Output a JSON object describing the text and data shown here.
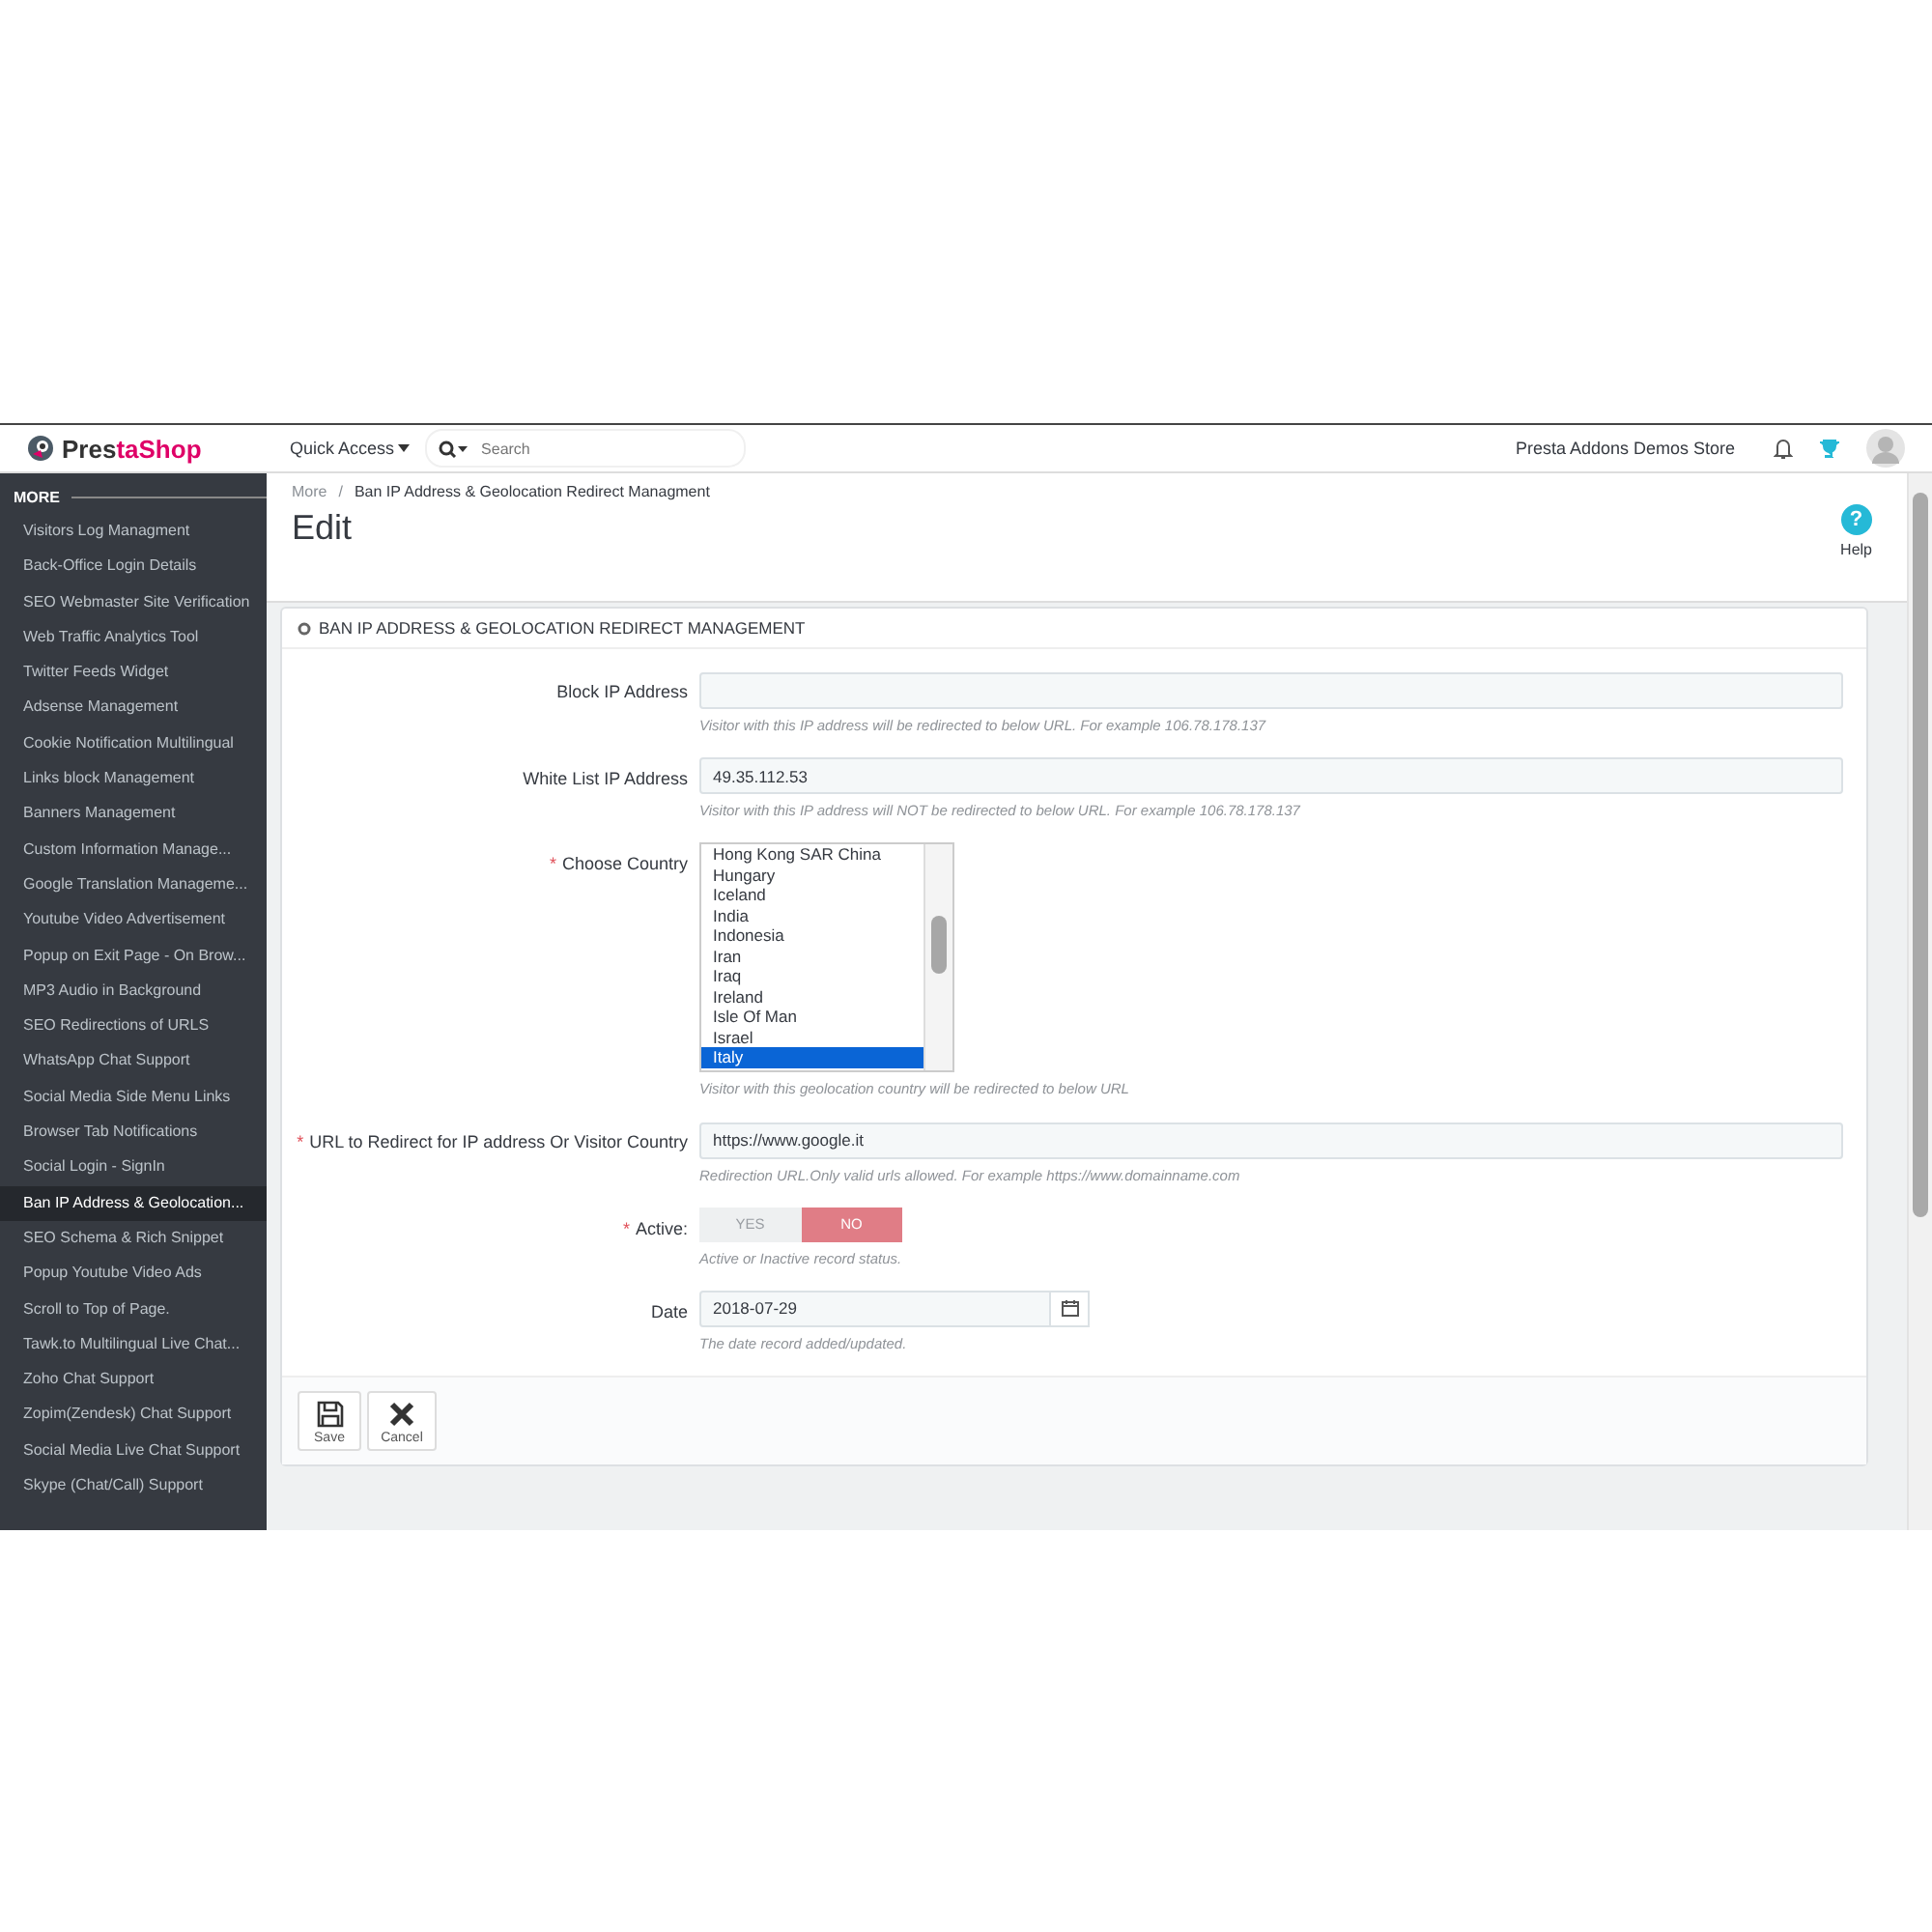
{
  "header": {
    "logo": "PrestaShop",
    "quick_access": "Quick Access",
    "search": {
      "placeholder": "Search"
    },
    "shop_name": "Presta Addons Demos Store"
  },
  "sidebar": {
    "section": "MORE",
    "items": [
      {
        "label": "Visitors Log Managment",
        "selected": false
      },
      {
        "label": "Back-Office Login Details",
        "selected": false
      },
      {
        "label": "SEO Webmaster Site Verification",
        "selected": false
      },
      {
        "label": "Web Traffic Analytics Tool",
        "selected": false
      },
      {
        "label": "Twitter Feeds Widget",
        "selected": false
      },
      {
        "label": "Adsense Management",
        "selected": false
      },
      {
        "label": "Cookie Notification Multilingual",
        "selected": false
      },
      {
        "label": "Links block Management",
        "selected": false
      },
      {
        "label": "Banners Management",
        "selected": false
      },
      {
        "label": "Custom Information Manage...",
        "selected": false
      },
      {
        "label": "Google Translation Manageme...",
        "selected": false
      },
      {
        "label": "Youtube Video Advertisement",
        "selected": false
      },
      {
        "label": "Popup on Exit Page - On Brow...",
        "selected": false
      },
      {
        "label": "MP3 Audio in Background",
        "selected": false
      },
      {
        "label": "SEO Redirections of URLS",
        "selected": false
      },
      {
        "label": "WhatsApp Chat Support",
        "selected": false
      },
      {
        "label": "Social Media Side Menu Links",
        "selected": false
      },
      {
        "label": "Browser Tab Notifications",
        "selected": false
      },
      {
        "label": "Social Login - SignIn",
        "selected": false
      },
      {
        "label": "Ban IP Address & Geolocation...",
        "selected": true
      },
      {
        "label": "SEO Schema & Rich Snippet",
        "selected": false
      },
      {
        "label": "Popup Youtube Video Ads",
        "selected": false
      },
      {
        "label": "Scroll to Top of Page.",
        "selected": false
      },
      {
        "label": "Tawk.to Multilingual Live Chat...",
        "selected": false
      },
      {
        "label": "Zoho Chat Support",
        "selected": false
      },
      {
        "label": "Zopim(Zendesk) Chat Support",
        "selected": false
      },
      {
        "label": "Social Media Live Chat Support",
        "selected": false
      },
      {
        "label": "Skype (Chat/Call) Support",
        "selected": false
      }
    ]
  },
  "breadcrumb": {
    "items": [
      "More",
      "Ban IP Address & Geolocation Redirect Managment"
    ],
    "separator": "/"
  },
  "page_title": "Edit",
  "help": {
    "glyph": "?",
    "label": "Help"
  },
  "panel": {
    "title": "BAN IP ADDRESS & GEOLOCATION REDIRECT MANAGEMENT",
    "fields": [
      {
        "kind": "text",
        "label": "Block IP Address",
        "hint": "Visitor with this IP address will be redirected to below URL. For example 106.78.178.137"
      },
      {
        "kind": "text",
        "label": "White List IP Address",
        "value": "49.35.112.53",
        "hint": "Visitor with this IP address will NOT be redirected to below URL. For example 106.78.178.137"
      },
      {
        "kind": "list",
        "required_mark": "*",
        "label": "Choose Country",
        "options": [
          {
            "label": "Hong Kong SAR China",
            "selected": false
          },
          {
            "label": "Hungary",
            "selected": false
          },
          {
            "label": "Iceland",
            "selected": false
          },
          {
            "label": "India",
            "selected": false
          },
          {
            "label": "Indonesia",
            "selected": false
          },
          {
            "label": "Iran",
            "selected": false
          },
          {
            "label": "Iraq",
            "selected": false
          },
          {
            "label": "Ireland",
            "selected": false
          },
          {
            "label": "Isle Of Man",
            "selected": false
          },
          {
            "label": "Israel",
            "selected": false
          },
          {
            "label": "Italy",
            "selected": true
          }
        ],
        "hint": "Visitor with this geolocation country will be redirected to below URL"
      },
      {
        "kind": "text",
        "required_mark": "*",
        "label": "URL to Redirect for IP address Or Visitor Country",
        "value": "https://www.google.it",
        "hint": "Redirection URL.Only valid urls allowed. For example https://www.domainname.com"
      },
      {
        "kind": "switch",
        "required_mark": "*",
        "label": "Active:",
        "options": [
          {
            "label": "YES",
            "selected": false
          },
          {
            "label": "NO",
            "selected": true
          }
        ],
        "hint": "Active or Inactive record status."
      },
      {
        "kind": "date",
        "label": "Date",
        "value": "2018-07-29",
        "hint": "The date record added/updated."
      }
    ]
  },
  "buttons": [
    {
      "kind": "save",
      "label": "Save"
    },
    {
      "kind": "cancel",
      "label": "Cancel"
    }
  ]
}
